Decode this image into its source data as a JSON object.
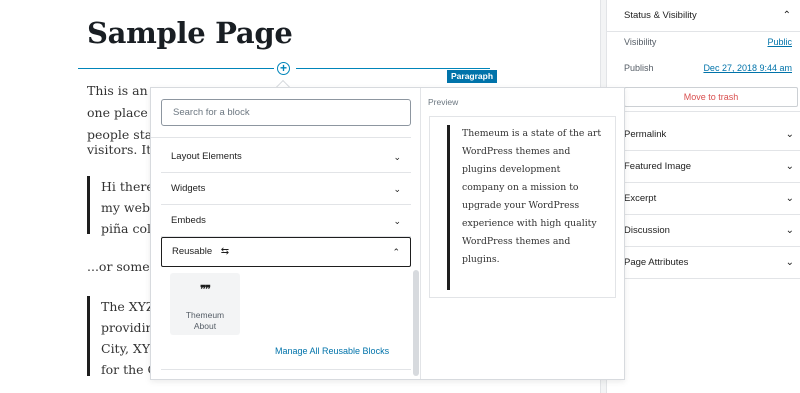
{
  "editor": {
    "page_title": "Sample Page",
    "block_badge": "Paragraph",
    "paragraph_lines": [
      "This is an ex",
      "one place ar",
      "people start",
      "visitors. It m"
    ],
    "quote1_lines": [
      "Hi there!",
      "my websi",
      "piña colac"
    ],
    "paragraph2": "...or somethi",
    "quote2_lines": [
      "The XYZ I",
      "providing",
      "City, XYZ",
      "for the Go"
    ]
  },
  "sidebar": {
    "status_title": "Status & Visibility",
    "visibility_label": "Visibility",
    "visibility_value": "Public",
    "publish_label": "Publish",
    "publish_value": "Dec 27, 2018 9:44 am",
    "trash_label": "Move to trash",
    "panels": [
      "Permalink",
      "Featured Image",
      "Excerpt",
      "Discussion",
      "Page Attributes"
    ]
  },
  "inserter": {
    "search_placeholder": "Search for a block",
    "categories": [
      "Layout Elements",
      "Widgets",
      "Embeds"
    ],
    "open_category": "Reusable",
    "block_icon": "❞❞",
    "block_label_line1": "Themeum",
    "block_label_line2": "About",
    "manage_link": "Manage All Reusable Blocks",
    "preview_label": "Preview",
    "preview_text_lines": [
      "Themeum is a state of the art",
      "WordPress themes and",
      "plugins development",
      "company on a mission to",
      "upgrade your WordPress",
      "experience with high quality",
      "WordPress themes and",
      "plugins."
    ]
  },
  "colors": {
    "accent": "#0073aa",
    "inserter_line": "#0085ba",
    "danger": "#d94f4f"
  },
  "icons": {
    "chevron_down": "chevron-down-icon",
    "chevron_up": "chevron-up-icon",
    "plus": "plus-circle-icon",
    "reusable": "reusable-block-icon",
    "quote_block": "quote-block-icon"
  }
}
